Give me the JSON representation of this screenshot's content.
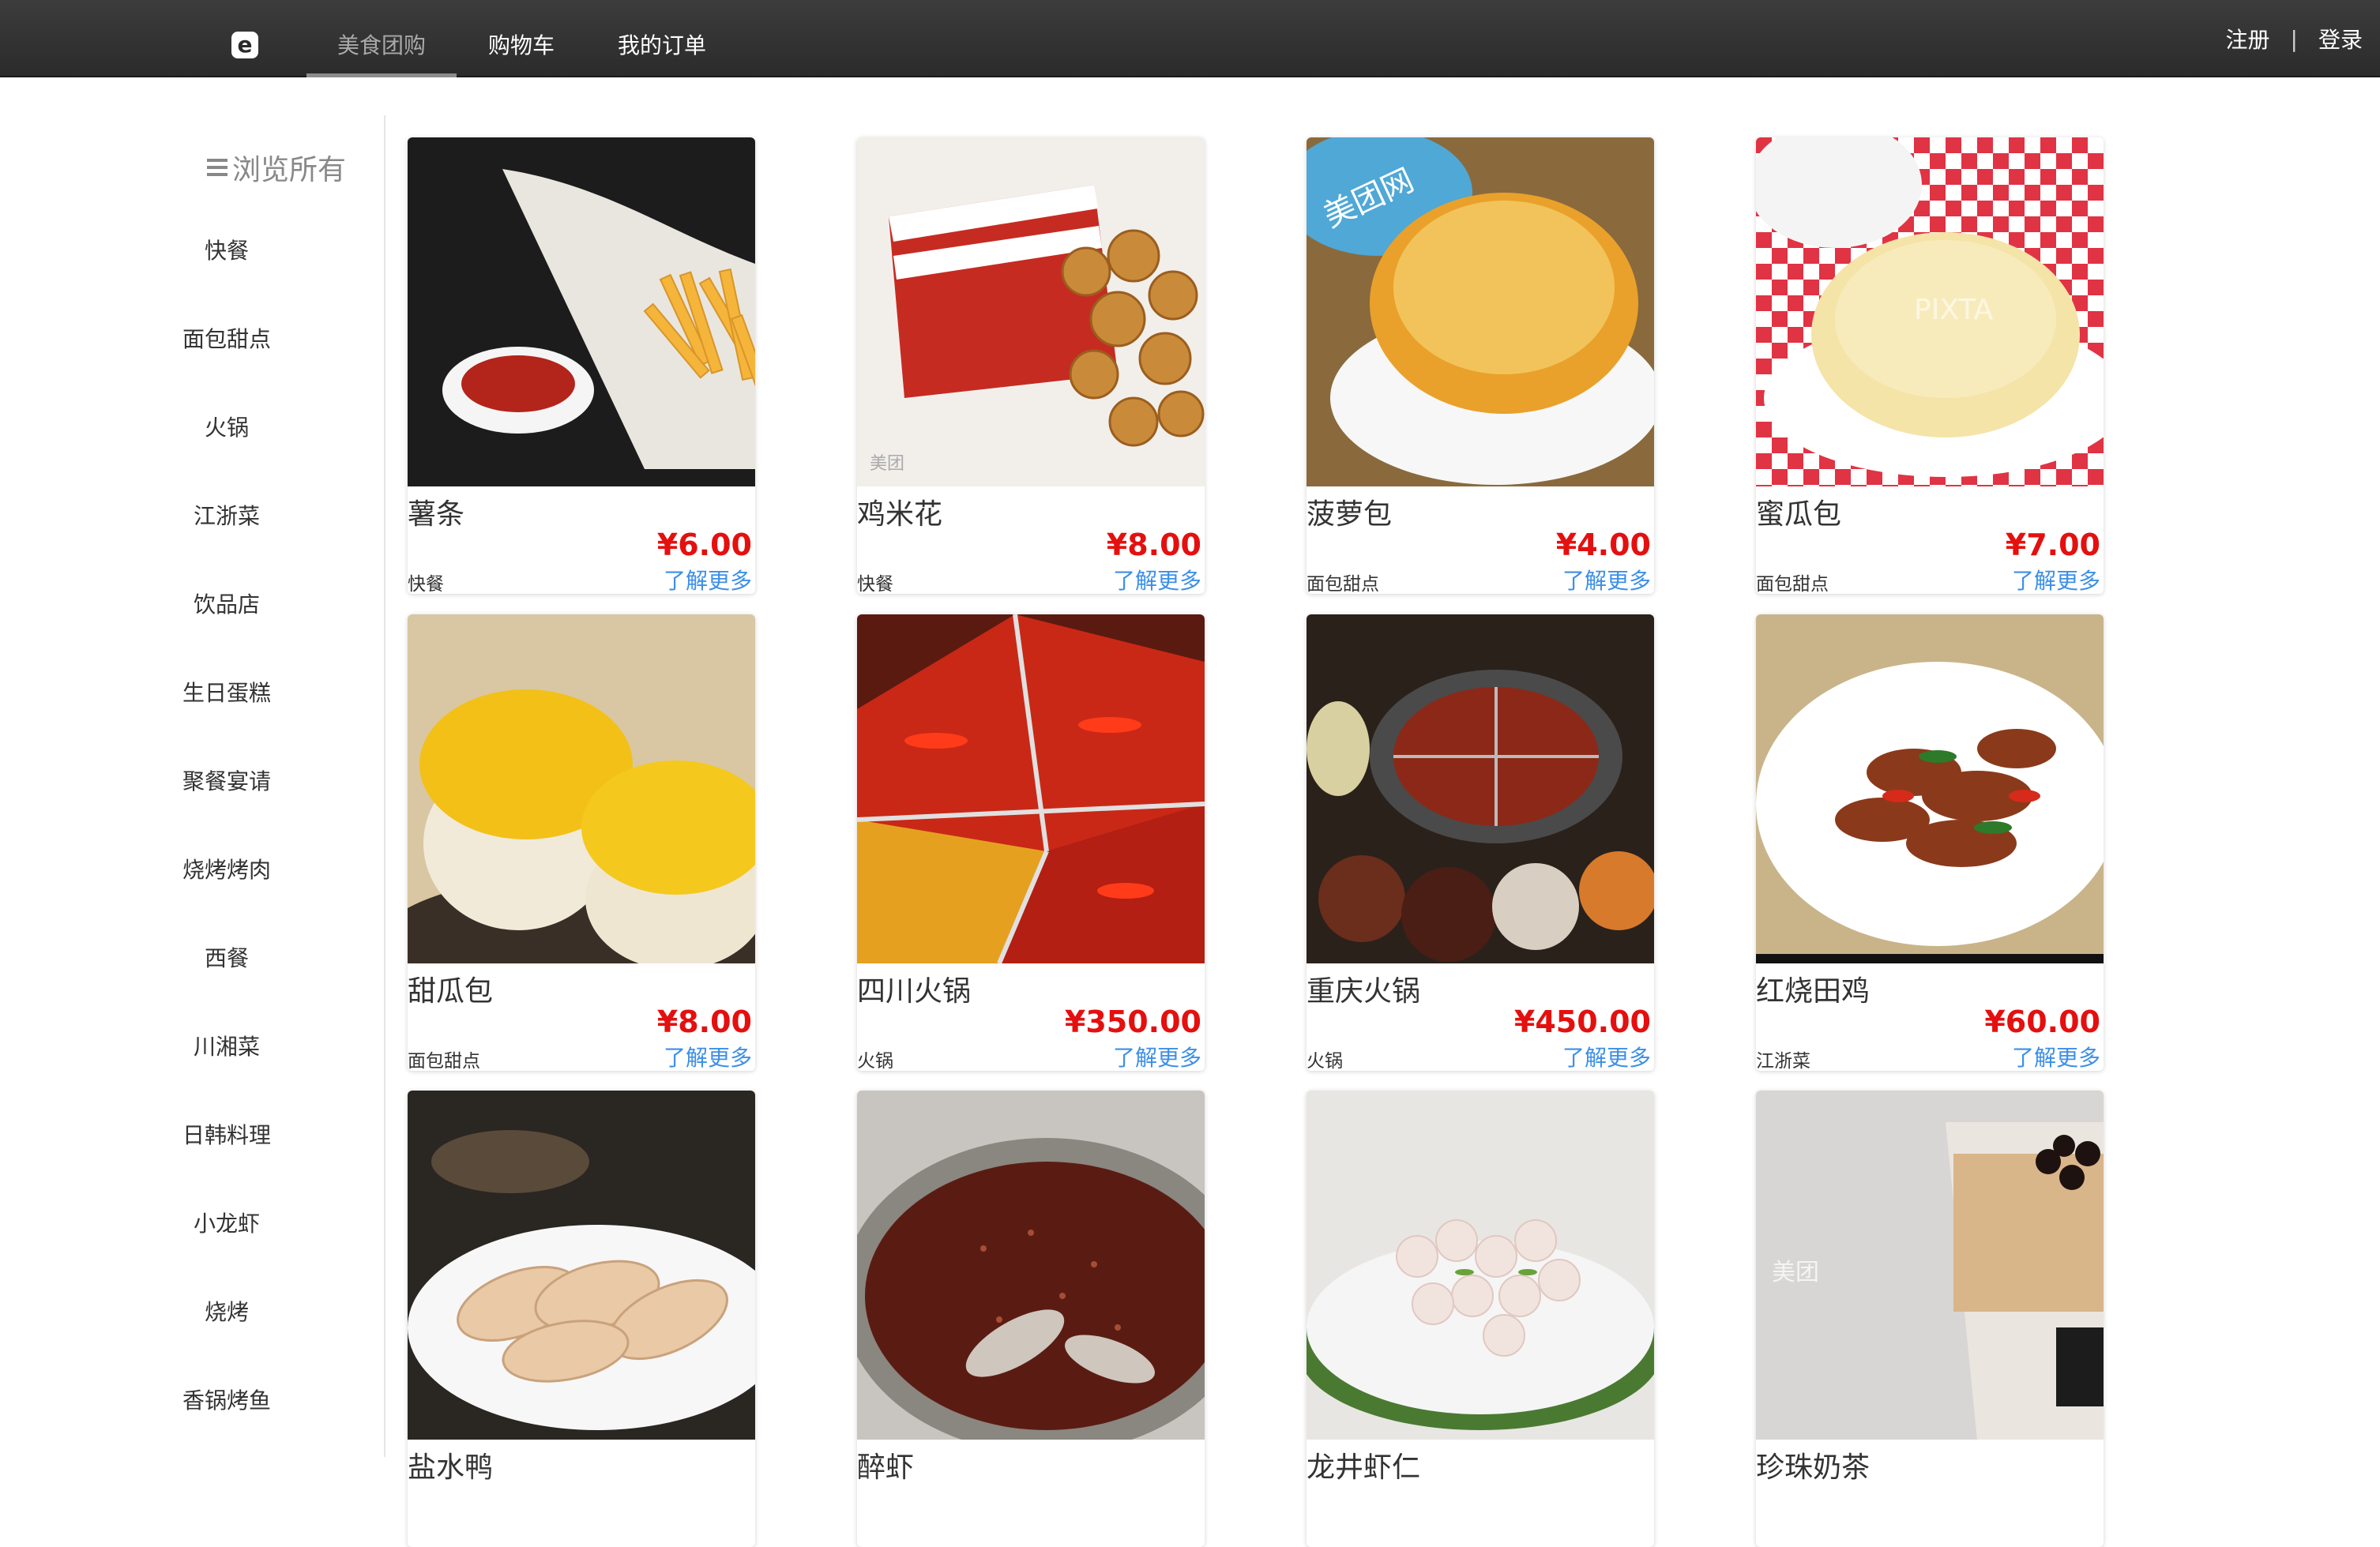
{
  "navbar": {
    "brand_glyph": "e",
    "tabs": [
      {
        "label": "美食团购",
        "active": true
      },
      {
        "label": "购物车",
        "active": false
      },
      {
        "label": "我的订单",
        "active": false
      }
    ],
    "register": "注册",
    "separator": "|",
    "login": "登录"
  },
  "sidebar": {
    "title": "浏览所有",
    "categories": [
      "快餐",
      "面包甜点",
      "火锅",
      "江浙菜",
      "饮品店",
      "生日蛋糕",
      "聚餐宴请",
      "烧烤烤肉",
      "西餐",
      "川湘菜",
      "日韩料理",
      "小龙虾",
      "烧烤",
      "香锅烤鱼"
    ]
  },
  "products": [
    {
      "name": "薯条",
      "price": "¥6.00",
      "category": "快餐",
      "more": "了解更多",
      "image": "fries-photo"
    },
    {
      "name": "鸡米花",
      "price": "¥8.00",
      "category": "快餐",
      "more": "了解更多",
      "image": "popcorn-chicken-photo",
      "watermark": "美团"
    },
    {
      "name": "菠萝包",
      "price": "¥4.00",
      "category": "面包甜点",
      "more": "了解更多",
      "image": "pineapple-bun-photo",
      "watermark": "美团网"
    },
    {
      "name": "蜜瓜包",
      "price": "¥7.00",
      "category": "面包甜点",
      "more": "了解更多",
      "image": "melon-bun-photo",
      "watermark": "PIXTA"
    },
    {
      "name": "甜瓜包",
      "price": "¥8.00",
      "category": "面包甜点",
      "more": "了解更多",
      "image": "sweet-melon-bun-photo"
    },
    {
      "name": "四川火锅",
      "price": "¥350.00",
      "category": "火锅",
      "more": "了解更多",
      "image": "sichuan-hotpot-photo"
    },
    {
      "name": "重庆火锅",
      "price": "¥450.00",
      "category": "火锅",
      "more": "了解更多",
      "image": "chongqing-hotpot-photo"
    },
    {
      "name": "红烧田鸡",
      "price": "¥60.00",
      "category": "江浙菜",
      "more": "了解更多",
      "image": "braised-frog-photo"
    },
    {
      "name": "盐水鸭",
      "price": "",
      "category": "",
      "more": "",
      "image": "salted-duck-photo"
    },
    {
      "name": "醉虾",
      "price": "",
      "category": "",
      "more": "",
      "image": "drunken-shrimp-photo"
    },
    {
      "name": "龙井虾仁",
      "price": "",
      "category": "",
      "more": "",
      "image": "longjing-shrimp-photo"
    },
    {
      "name": "珍珠奶茶",
      "price": "",
      "category": "",
      "more": "",
      "image": "bubble-tea-photo",
      "watermark": "美团"
    }
  ],
  "colors": {
    "navbar_bg": "#2e2e2e",
    "price_red": "#e4100f",
    "link_blue": "#3d8fe8"
  }
}
